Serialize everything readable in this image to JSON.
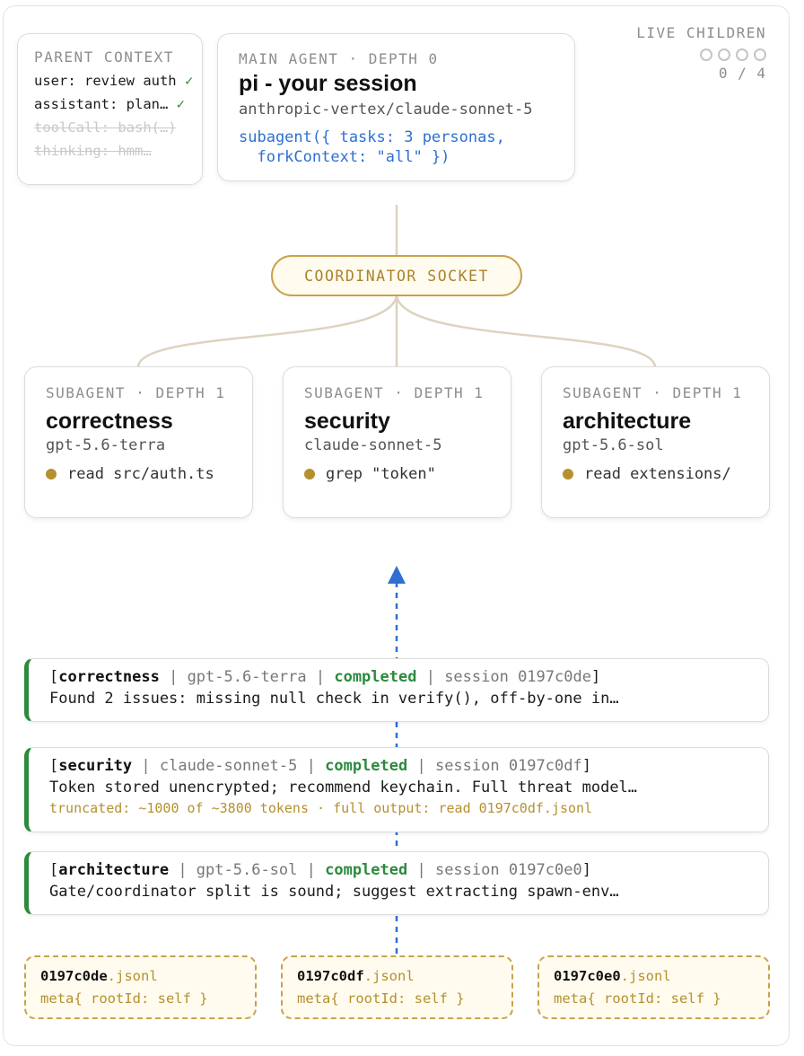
{
  "parent_context": {
    "label": "PARENT CONTEXT",
    "lines": [
      {
        "text": "user: review auth",
        "check": "✓"
      },
      {
        "text": "assistant: plan…",
        "check": "✓"
      },
      {
        "text": "toolCall: bash(…)"
      },
      {
        "text": "thinking: hmm…"
      }
    ]
  },
  "main_agent": {
    "label": "MAIN AGENT · DEPTH 0",
    "title": "pi - your session",
    "model": "anthropic-vertex/claude-sonnet-5",
    "call": "subagent({ tasks: 3 personas,\n  forkContext: \"all\" })"
  },
  "live_children": {
    "label": "LIVE CHILDREN",
    "count": "0 / 4"
  },
  "socket": {
    "label": "COORDINATOR SOCKET"
  },
  "subagents": [
    {
      "label": "SUBAGENT · DEPTH 1",
      "name": "correctness",
      "model": "gpt-5.6-terra",
      "activity": "read src/auth.ts"
    },
    {
      "label": "SUBAGENT · DEPTH 1",
      "name": "security",
      "model": "claude-sonnet-5",
      "activity": "grep \"token\""
    },
    {
      "label": "SUBAGENT · DEPTH 1",
      "name": "architecture",
      "model": "gpt-5.6-sol",
      "activity": "read extensions/"
    }
  ],
  "results": [
    {
      "name": "correctness",
      "model": "gpt-5.6-terra",
      "status": "completed",
      "session": "session 0197c0de",
      "body": "Found 2 issues: missing null check in verify(), off-by-one in…"
    },
    {
      "name": "security",
      "model": "claude-sonnet-5",
      "status": "completed",
      "session": "session 0197c0df",
      "body": "Token stored unencrypted; recommend keychain. Full threat model…",
      "truncated": "truncated: ~1000 of ~3800 tokens · full output: read 0197c0df.jsonl"
    },
    {
      "name": "architecture",
      "model": "gpt-5.6-sol",
      "status": "completed",
      "session": "session 0197c0e0",
      "body": "Gate/coordinator split is sound; suggest extracting spawn-env…"
    }
  ],
  "files": [
    {
      "id": "0197c0de",
      "ext": ".jsonl",
      "meta": "meta{ rootId: self }"
    },
    {
      "id": "0197c0df",
      "ext": ".jsonl",
      "meta": "meta{ rootId: self }"
    },
    {
      "id": "0197c0e0",
      "ext": ".jsonl",
      "meta": "meta{ rootId: self }"
    }
  ],
  "colors": {
    "accent_gold": "#c8a24a",
    "completed_green": "#2d8a3e",
    "call_blue": "#2f6fd1",
    "connector": "#ddd3bf"
  }
}
